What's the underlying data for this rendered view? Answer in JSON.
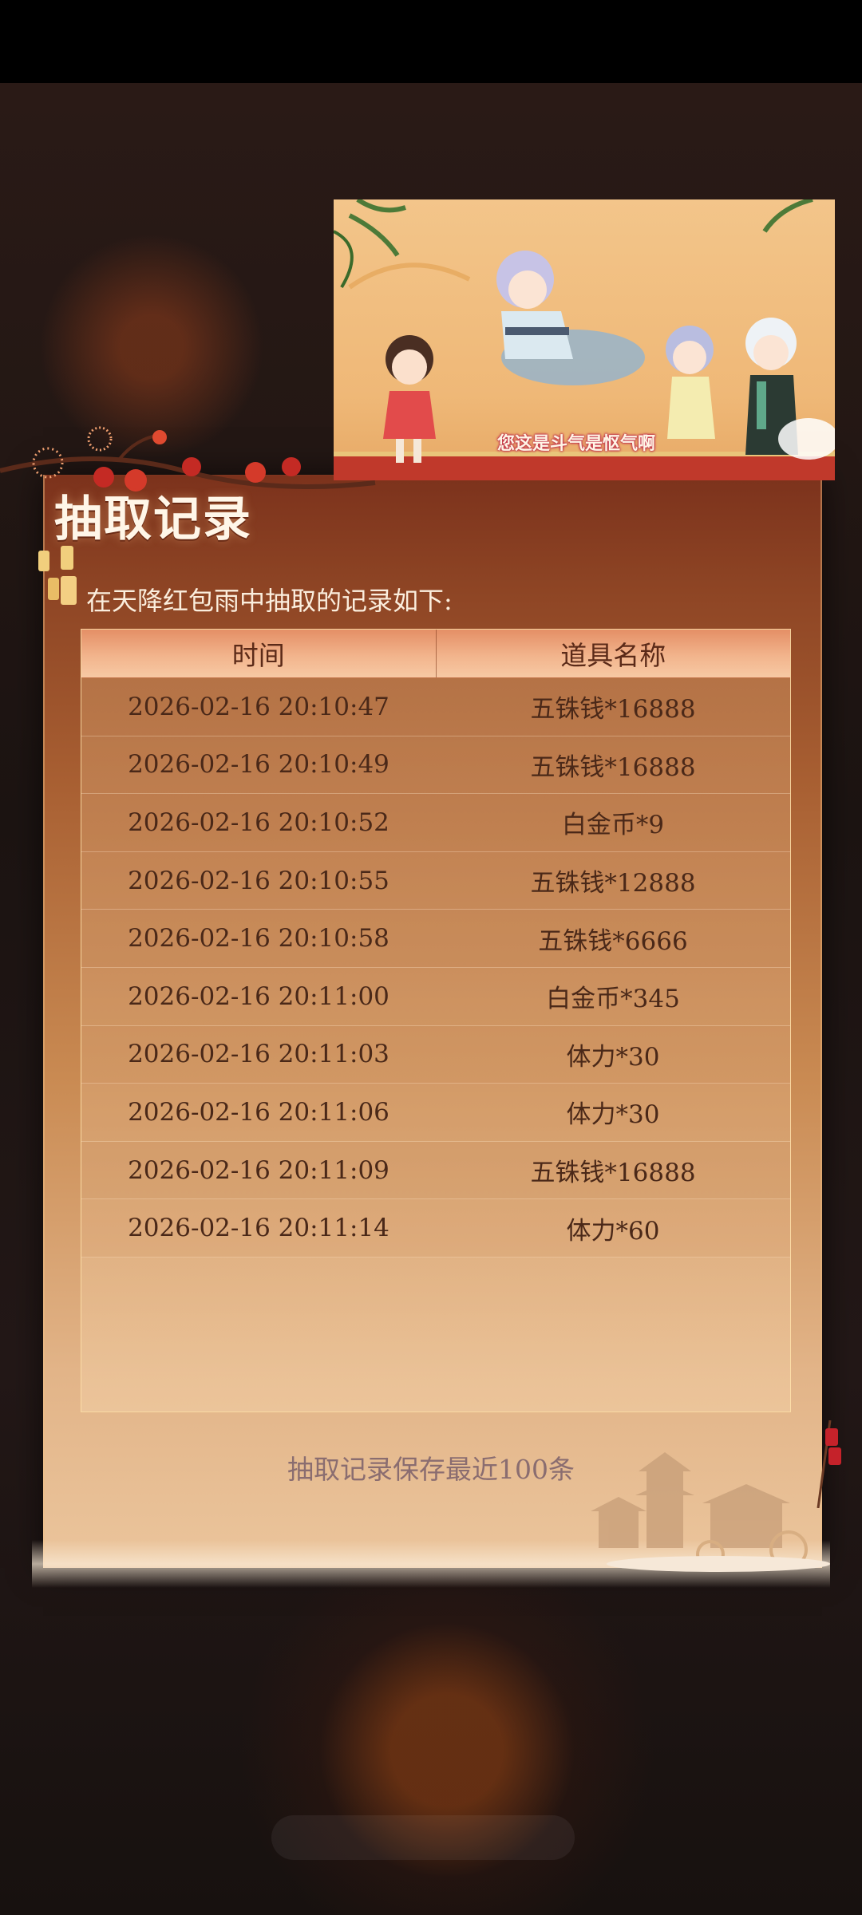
{
  "panel": {
    "title": "抽取记录",
    "subtitle": "在天降红包雨中抽取的记录如下:",
    "table": {
      "headers": [
        "时间",
        "道具名称"
      ],
      "rows": [
        {
          "time": "2026-02-16 20:10:47",
          "item": "五铢钱*16888"
        },
        {
          "time": "2026-02-16 20:10:49",
          "item": "五铢钱*16888"
        },
        {
          "time": "2026-02-16 20:10:52",
          "item": "白金币*9"
        },
        {
          "time": "2026-02-16 20:10:55",
          "item": "五铢钱*12888"
        },
        {
          "time": "2026-02-16 20:10:58",
          "item": "五铢钱*6666"
        },
        {
          "time": "2026-02-16 20:11:00",
          "item": "白金币*345"
        },
        {
          "time": "2026-02-16 20:11:03",
          "item": "体力*30"
        },
        {
          "time": "2026-02-16 20:11:06",
          "item": "体力*30"
        },
        {
          "time": "2026-02-16 20:11:09",
          "item": "五铢钱*16888"
        },
        {
          "time": "2026-02-16 20:11:14",
          "item": "体力*60"
        }
      ]
    },
    "footer_note": "抽取记录保存最近100条"
  },
  "video": {
    "caption": "您这是斗气是怄气啊"
  }
}
